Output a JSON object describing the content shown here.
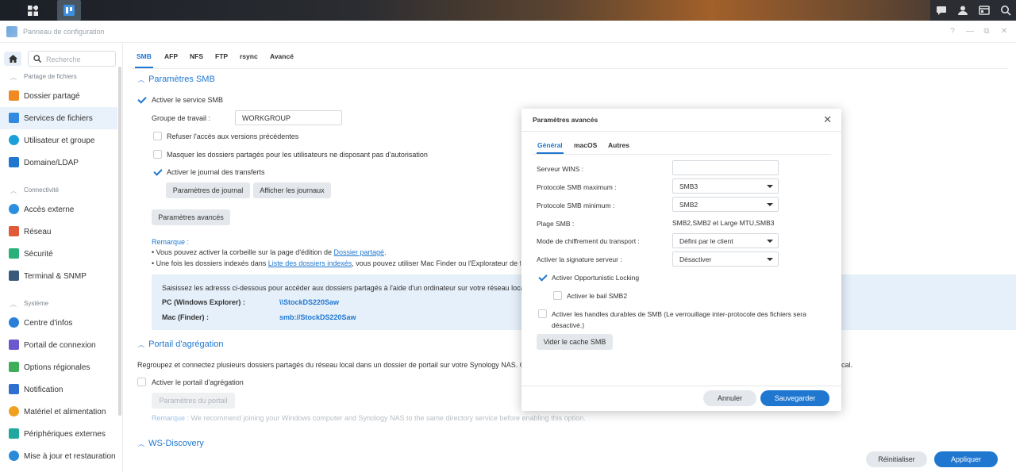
{
  "window": {
    "title": "Panneau de configuration"
  },
  "sidebar": {
    "search_placeholder": "Recherche",
    "sections": [
      {
        "label": "Partage de fichiers"
      },
      {
        "label": "Connectivité"
      },
      {
        "label": "Système"
      }
    ],
    "items": [
      {
        "label": "Dossier partagé",
        "color": "#f08a24"
      },
      {
        "label": "Services de fichiers",
        "color": "#2f8ae0"
      },
      {
        "label": "Utilisateur et groupe",
        "color": "#1ca0d8"
      },
      {
        "label": "Domaine/LDAP",
        "color": "#1f77d0"
      },
      {
        "label": "Accès externe",
        "color": "#2a8fe0"
      },
      {
        "label": "Réseau",
        "color": "#e05a3a"
      },
      {
        "label": "Sécurité",
        "color": "#2ab07a"
      },
      {
        "label": "Terminal & SNMP",
        "color": "#3b5a7a"
      },
      {
        "label": "Centre d'infos",
        "color": "#2a7fd8"
      },
      {
        "label": "Portail de connexion",
        "color": "#6a5acd"
      },
      {
        "label": "Options régionales",
        "color": "#3fae5a"
      },
      {
        "label": "Notification",
        "color": "#2f6fd0"
      },
      {
        "label": "Matériel et alimentation",
        "color": "#f0a020"
      },
      {
        "label": "Périphériques externes",
        "color": "#20a8a0"
      },
      {
        "label": "Mise à jour et restauration",
        "color": "#2a8ad8"
      }
    ]
  },
  "main": {
    "tabs": [
      "SMB",
      "AFP",
      "NFS",
      "FTP",
      "rsync",
      "Avancé"
    ],
    "smb": {
      "heading": "Paramètres SMB",
      "enable_label": "Activer le service SMB",
      "workgroup_label": "Groupe de travail :",
      "workgroup_value": "WORKGROUP",
      "deny_prev_label": "Refuser l'accès aux versions précédentes",
      "hide_folders_label": "Masquer les dossiers partagés pour les utilisateurs ne disposant pas d'autorisation",
      "transfer_log_label": "Activer le journal des transferts",
      "log_settings_btn": "Paramètres de journal",
      "view_logs_btn": "Afficher les journaux",
      "advanced_btn": "Paramètres avancés",
      "note_title": "Remarque :",
      "note1_pre": "Vous pouvez activer la corbeille sur la page d'édition de ",
      "note1_link": "Dossier partagé",
      "note1_post": ".",
      "note2_pre": "Une fois les dossiers indexés dans ",
      "note2_link": "Liste des dossiers indexés",
      "note2_post": ", vous pouvez utiliser Mac Finder ou l'Explorateur de fich",
      "info_text": "Saisissez les adresss ci-dessous pour accéder aux dossiers partagés à l'aide d'un ordinateur sur votre réseau local :",
      "pc_label": "PC (Windows Explorer) :",
      "pc_value": "\\\\StockDS220Saw",
      "mac_label": "Mac (Finder) :",
      "mac_value": "smb://StockDS220Saw"
    },
    "portal": {
      "heading": "Portail d'agrégation",
      "desc": "Regroupez et connectez plusieurs dossiers partagés du réseau local dans un dossier de portail sur votre Synology NAS. Cette",
      "desc_tail": "ocal.",
      "enable_label": "Activer le portail d'agrégation",
      "settings_btn": "Paramètres du portail",
      "note_label": "Remarque :",
      "note_text": " We recommend joining your Windows computer and Synology NAS to the same directory service before enabling this option."
    },
    "wsd": {
      "heading": "WS-Discovery"
    },
    "reset_btn": "Réinitialiser",
    "apply_btn": "Appliquer"
  },
  "modal": {
    "title": "Paramètres avancés",
    "tabs": [
      "Général",
      "macOS",
      "Autres"
    ],
    "wins_label": "Serveur WINS :",
    "wins_value": "",
    "max_proto_label": "Protocole SMB maximum :",
    "max_proto_value": "SMB3",
    "min_proto_label": "Protocole SMB minimum :",
    "min_proto_value": "SMB2",
    "range_label": "Plage SMB :",
    "range_value": "SMB2,SMB2 et Large MTU,SMB3",
    "encryption_label": "Mode de chiffrement du transport :",
    "encryption_value": "Défini par le client",
    "signing_label": "Activer la signature serveur :",
    "signing_value": "Désactiver",
    "oplock_label": "Activer Opportunistic Locking",
    "lease_label": "Activer le bail SMB2",
    "durable_label": "Activer les handles durables de SMB (Le verrouillage inter-protocole des fichiers sera",
    "durable_label2": "désactivé.)",
    "clear_cache_btn": "Vider le cache SMB",
    "cancel_btn": "Annuler",
    "save_btn": "Sauvegarder"
  }
}
